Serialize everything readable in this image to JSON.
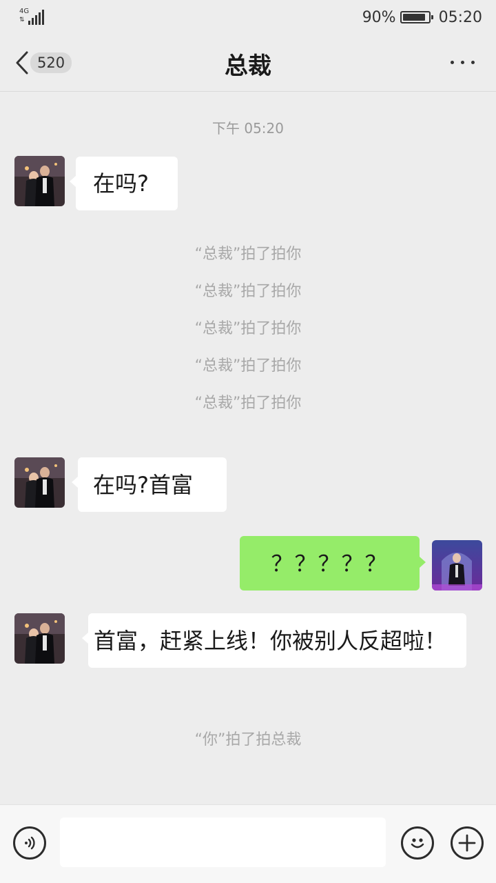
{
  "status_bar": {
    "network": "4G",
    "battery_percent_label": "90%",
    "battery_level": 0.9,
    "time": "05:20"
  },
  "header": {
    "back_icon": "chevron-left-icon",
    "unread_count": "520",
    "title": "总裁",
    "more_icon": "more-dots-icon"
  },
  "chat": {
    "timestamp": "下午 05:20",
    "messages": [
      {
        "sender": "总裁",
        "text": "在吗?"
      },
      {
        "sender": "总裁",
        "text": "在吗?首富"
      },
      {
        "sender": "me",
        "text": "？？？？？"
      },
      {
        "sender": "总裁",
        "text": "首富，赶紧上线！你被别人反超啦！"
      }
    ],
    "pat_notices": [
      "“总裁”拍了拍你",
      "“总裁”拍了拍你",
      "“总裁”拍了拍你",
      "“总裁”拍了拍你",
      "“总裁”拍了拍你"
    ],
    "my_pat_notice": "“你”拍了拍总裁"
  },
  "input_bar": {
    "voice_icon": "voice-icon",
    "text_value": "",
    "emoji_icon": "emoji-icon",
    "plus_icon": "plus-icon"
  },
  "colors": {
    "background": "#ededed",
    "incoming_bubble": "#ffffff",
    "outgoing_bubble": "#95ec69",
    "system_text": "#a8a8a8"
  }
}
